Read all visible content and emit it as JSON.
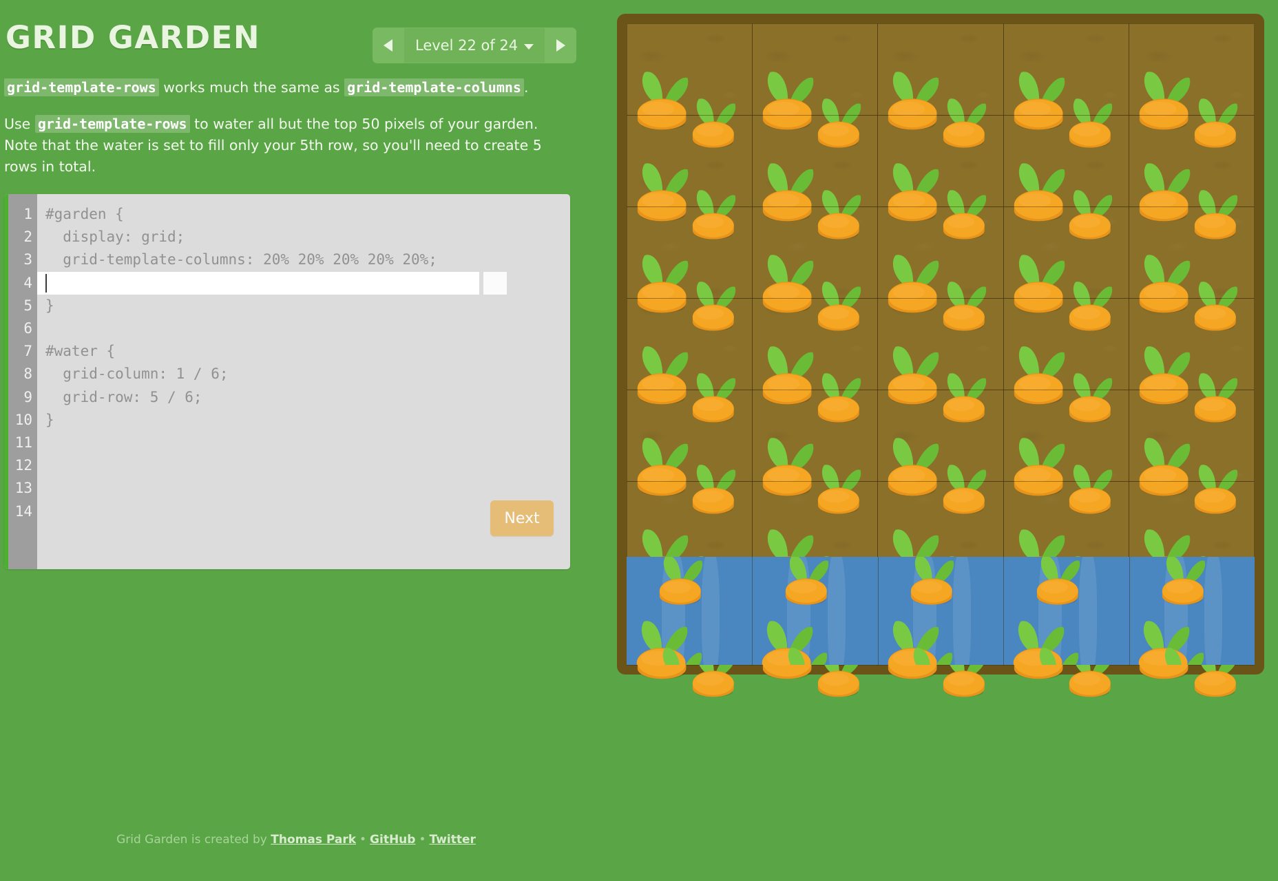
{
  "header": {
    "title": "GRID GARDEN",
    "level_prev_label": "previous level",
    "level_next_label": "next level",
    "level_text": "Level 22 of 24"
  },
  "instructions": {
    "p1_code_1": "grid-template-rows",
    "p1_mid": " works much the same as ",
    "p1_code_2": "grid-template-columns",
    "p1_end": ".",
    "p2_start": "Use ",
    "p2_code": "grid-template-rows",
    "p2_end": " to water all but the top 50 pixels of your garden. Note that the water is set to fill only your 5th row, so you'll need to create 5 rows in total."
  },
  "editor": {
    "line_numbers": [
      "1",
      "2",
      "3",
      "4",
      "5",
      "6",
      "7",
      "8",
      "9",
      "10",
      "11",
      "12",
      "13",
      "14"
    ],
    "lines": [
      "#garden {",
      "  display: grid;",
      "  grid-template-columns: 20% 20% 20% 20% 20%;",
      "",
      "}",
      "",
      "#water {",
      "  grid-column: 1 / 6;",
      "  grid-row: 5 / 6;",
      "}",
      "",
      "",
      "",
      ""
    ],
    "active_line_index": 3,
    "next_label": "Next"
  },
  "footer": {
    "prefix": "Grid Garden is created by ",
    "author": "Thomas Park",
    "sep": "•",
    "github": "GitHub",
    "twitter": "Twitter"
  },
  "garden": {
    "columns": 5,
    "plot_count": 35,
    "water_label": "water",
    "soil_label": "soil"
  },
  "colors": {
    "background_green": "#5aa545",
    "soil_brown": "#8a7029",
    "garden_border": "#6b5418",
    "water_blue": "#4a87c0",
    "carrot_orange": "#f5a623",
    "carrot_orange_dark": "#e8941a",
    "leaf_green_light": "#7ac943",
    "leaf_green_dark": "#5fb62f",
    "editor_bg": "#dcdcdc",
    "gutter_gray": "#9e9e9e",
    "next_button": "#e5bd77",
    "accent_green_bar": "#4caf2f"
  }
}
